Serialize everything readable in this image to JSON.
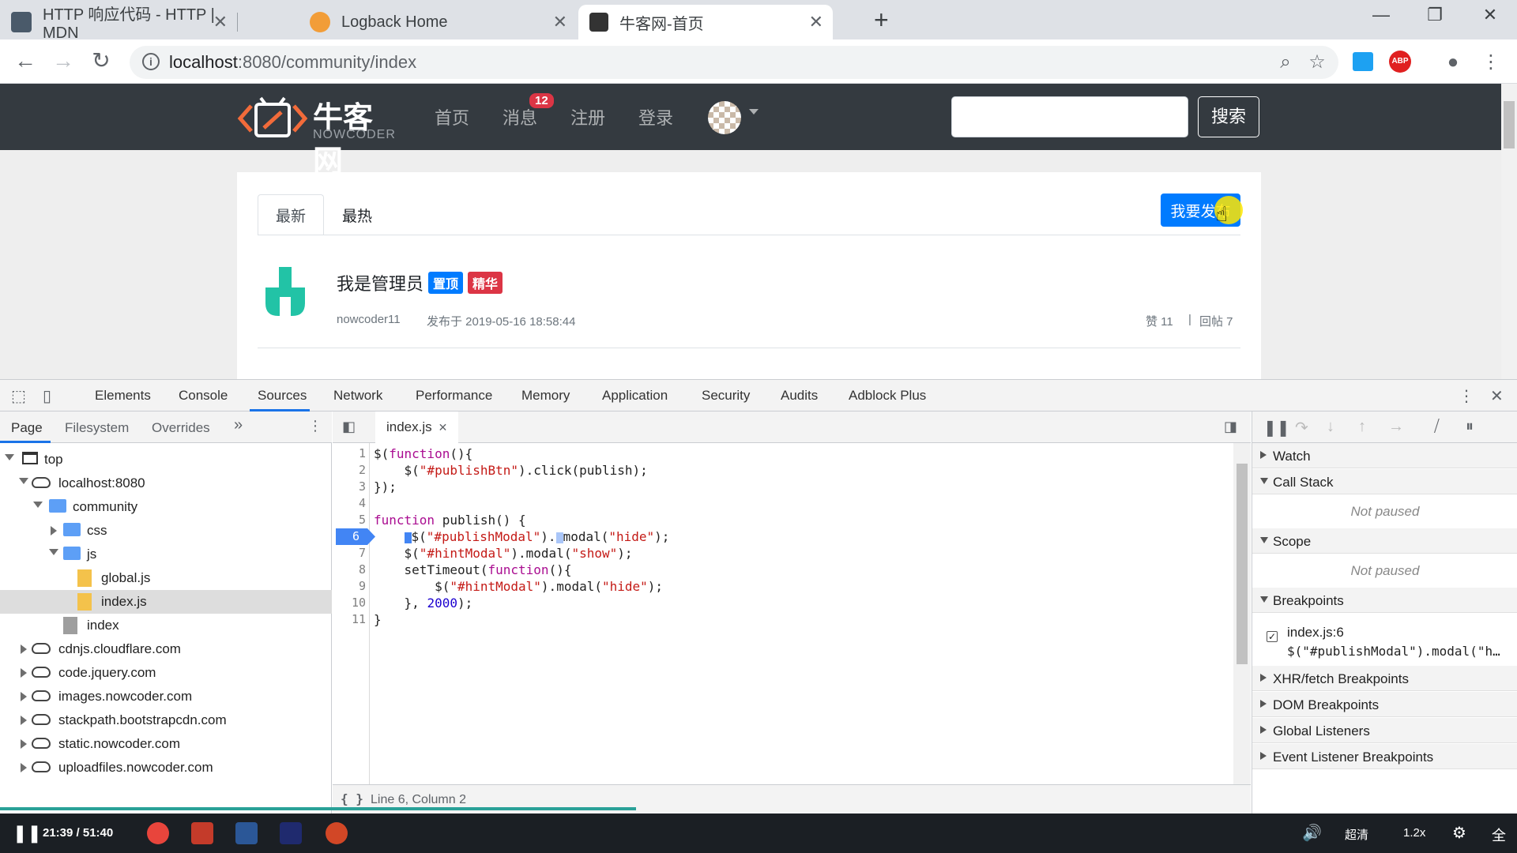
{
  "browser": {
    "tabs": [
      {
        "title": "HTTP 响应代码 - HTTP | MDN",
        "close": "✕"
      },
      {
        "title": "Logback Home",
        "close": "✕"
      },
      {
        "title": "牛客网-首页",
        "close": "✕"
      }
    ],
    "new_tab": "+",
    "window_controls": {
      "minimize": "—",
      "restore": "❐",
      "close": "✕"
    },
    "url_host": "localhost",
    "url_path": ":8080/community/index",
    "extension_abp": "ABP"
  },
  "site": {
    "logo_name": "牛客网",
    "logo_sub": "NOWCODER",
    "nav": {
      "home": "首页",
      "messages": "消息",
      "register": "注册",
      "login": "登录"
    },
    "message_badge": "12",
    "search_button": "搜索",
    "tabs": {
      "latest": "最新",
      "hot": "最热"
    },
    "publish_button": "我要发布",
    "post": {
      "title": "我是管理员",
      "badge_top": "置顶",
      "badge_essence": "精华",
      "author": "nowcoder11",
      "time": "发布于 2019-05-16 18:58:44",
      "likes": "赞 11",
      "separator": "|",
      "replies": "回帖 7"
    }
  },
  "devtools": {
    "tabs": [
      "Elements",
      "Console",
      "Sources",
      "Network",
      "Performance",
      "Memory",
      "Application",
      "Security",
      "Audits",
      "Adblock Plus"
    ],
    "active_tab": "Sources",
    "navigator_tabs": {
      "page": "Page",
      "filesystem": "Filesystem",
      "overrides": "Overrides",
      "more": "»"
    },
    "tree": {
      "top": "top",
      "host": "localhost:8080",
      "community": "community",
      "css": "css",
      "js": "js",
      "global_js": "global.js",
      "index_js": "index.js",
      "index": "index",
      "domains": [
        "cdnjs.cloudflare.com",
        "code.jquery.com",
        "images.nowcoder.com",
        "stackpath.bootstrapcdn.com",
        "static.nowcoder.com",
        "uploadfiles.nowcoder.com"
      ]
    },
    "editor": {
      "file_tab": "index.js",
      "file_tab_close": "✕",
      "line_numbers": [
        "1",
        "2",
        "3",
        "4",
        "5",
        "6",
        "7",
        "8",
        "9",
        "10",
        "11"
      ],
      "breakpoint_line": "6",
      "status": "Line 6, Column 2",
      "status_icon": "{ }"
    },
    "debugger": {
      "watch": "Watch",
      "call_stack": "Call Stack",
      "not_paused_1": "Not paused",
      "scope": "Scope",
      "not_paused_2": "Not paused",
      "breakpoints": "Breakpoints",
      "breakpoint_file": "index.js:6",
      "breakpoint_code": "$(\"#publishModal\").modal(\"h…",
      "xhr": "XHR/fetch Breakpoints",
      "dom": "DOM Breakpoints",
      "global": "Global Listeners",
      "event": "Event Listener Breakpoints"
    }
  },
  "player": {
    "time": "21:39 / 51:40",
    "quality": "超清",
    "speed": "1.2x",
    "fullscreen": "全"
  },
  "colors": {
    "accent": "#1a73e8",
    "site_nav": "#343a40",
    "primary_button": "#007bff",
    "badge_top": "#007bff",
    "badge_essence": "#dc3545",
    "breakpoint": "#4285f4"
  }
}
